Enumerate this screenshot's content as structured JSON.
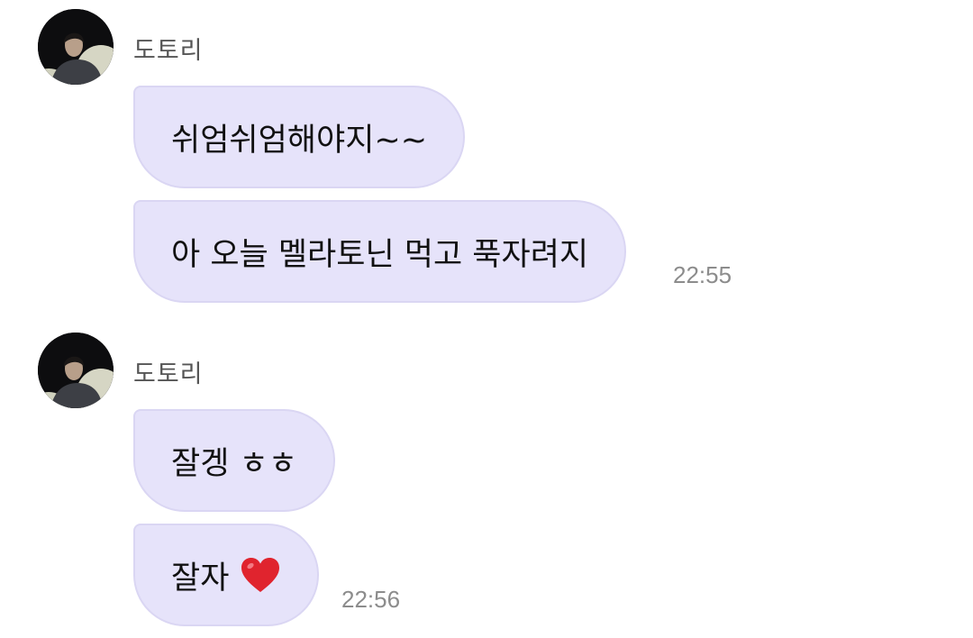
{
  "groups": [
    {
      "sender": "도토리",
      "messages": [
        {
          "text": "쉬엄쉬엄해야지~~"
        },
        {
          "text": "아 오늘 멜라토닌 먹고 푹자려지"
        }
      ],
      "time": "22:55"
    },
    {
      "sender": "도토리",
      "messages": [
        {
          "text": "잘겡 ㅎㅎ"
        },
        {
          "text": "잘자",
          "emoji": "red-heart-icon"
        }
      ],
      "time": "22:56"
    }
  ],
  "colors": {
    "bubble_bg": "#e6e3fa",
    "bubble_border": "#dad6f3",
    "sender_text": "#555555",
    "time_text": "#8c8c8c",
    "heart": "#e0242e"
  }
}
